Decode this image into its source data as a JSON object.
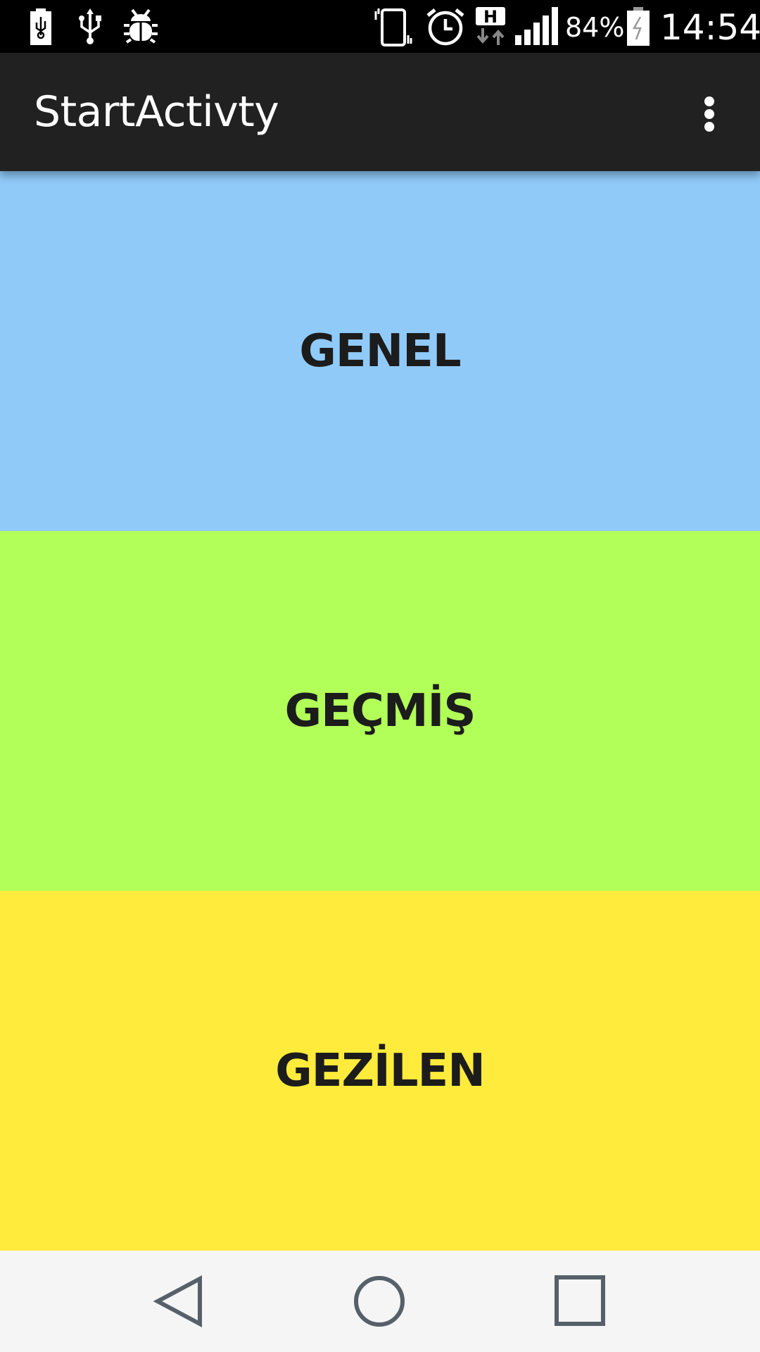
{
  "status_bar": {
    "battery_percent": "84%",
    "time": "14:54",
    "network_type": "H",
    "icons": [
      "battery-usb-icon",
      "usb-icon",
      "debug-bug-icon",
      "vibrate-icon",
      "alarm-icon",
      "network-h-icon",
      "signal-icon",
      "battery-charging-icon"
    ]
  },
  "app_bar": {
    "title": "StartActivty",
    "overflow_icon": "more-vert-icon"
  },
  "tiles": [
    {
      "label": "GENEL",
      "color": "#90caf9"
    },
    {
      "label": "GEÇMİŞ",
      "color": "#b2ff59"
    },
    {
      "label": "GEZİLEN",
      "color": "#ffeb3b"
    }
  ],
  "nav_bar": {
    "icons": [
      "back-icon",
      "home-icon",
      "recents-icon"
    ]
  }
}
